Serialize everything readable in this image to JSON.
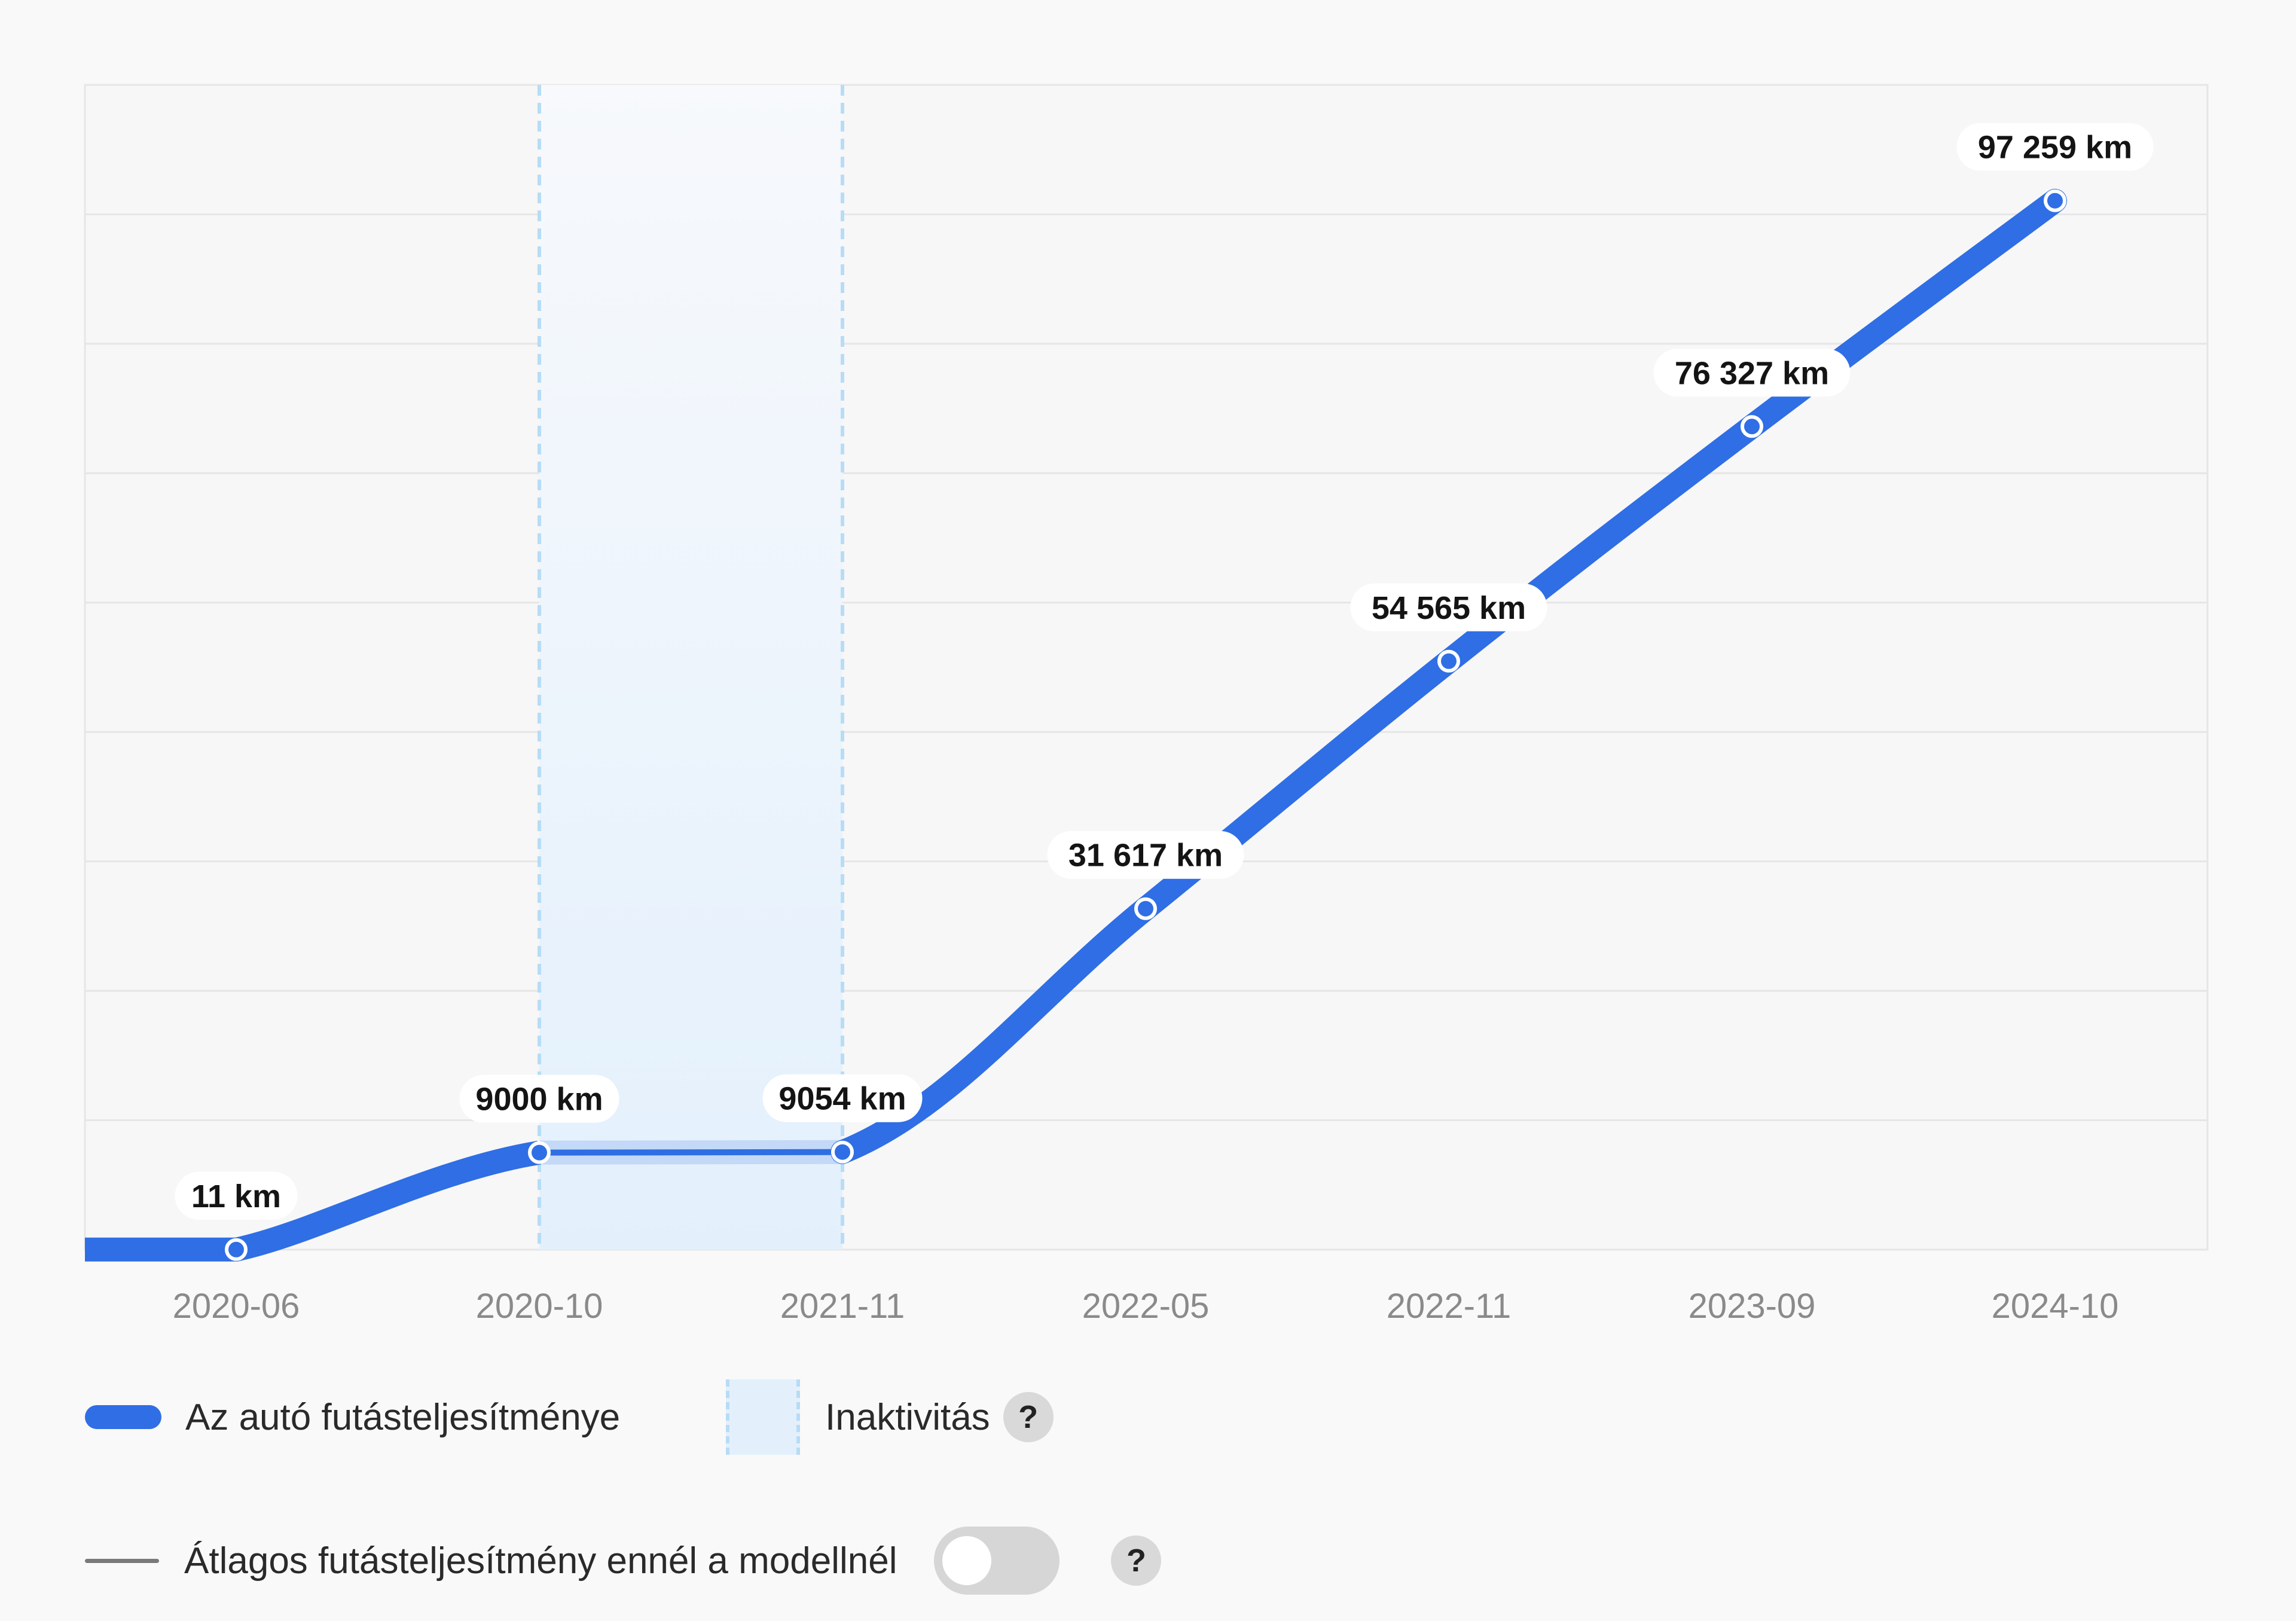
{
  "colors": {
    "line": "#2f6ee5",
    "inactive_fill": "#e3f0fc",
    "inactive_border": "#b7dcf5",
    "grid": "#e6e6e6",
    "average": "#7a7a7a"
  },
  "chart_data": {
    "type": "line",
    "categories": [
      "2020-06",
      "2020-10",
      "2021-11",
      "2022-05",
      "2022-11",
      "2023-09",
      "2024-10"
    ],
    "series": [
      {
        "name": "Az autó futásteljesítménye",
        "values": [
          11,
          9000,
          9054,
          31617,
          54565,
          76327,
          97259
        ],
        "labels": [
          "11 km",
          "9000 km",
          "9054 km",
          "31 617 km",
          "54 565 km",
          "76 327 km",
          "97 259 km"
        ]
      }
    ],
    "inactive_range": [
      "2020-10",
      "2021-11"
    ],
    "ylim": [
      0,
      108000
    ],
    "grid": true,
    "legend_position": "bottom"
  },
  "legend": {
    "series_label": "Az autó futásteljesítménye",
    "inactive_label": "Inaktivitás",
    "help_glyph": "?",
    "average_label": "Átlagos futásteljesítmény ennél a modellnél",
    "average_toggle_on": false
  }
}
